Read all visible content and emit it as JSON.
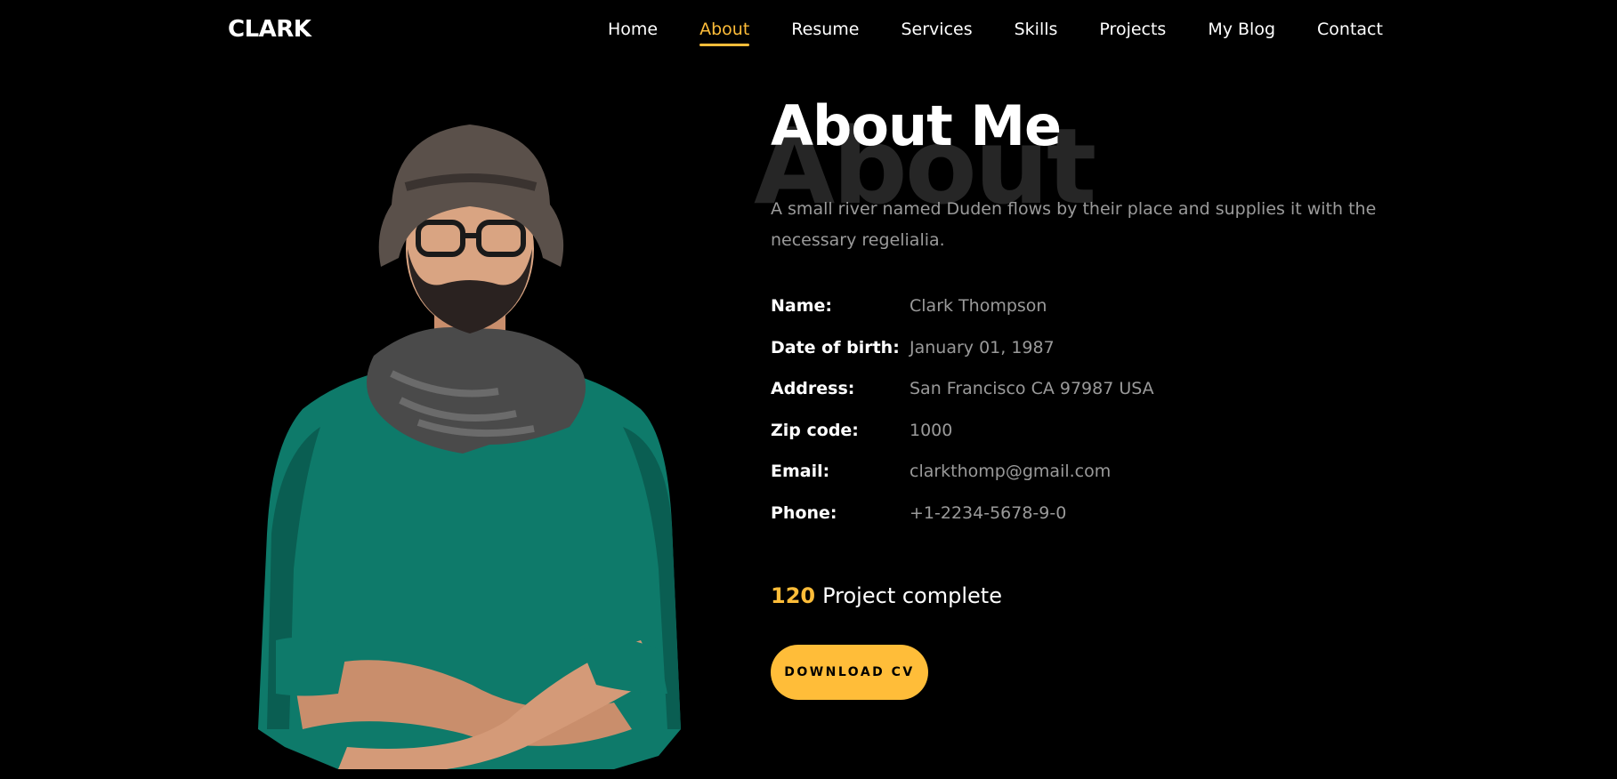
{
  "brand": "CLARK",
  "nav": {
    "items": [
      {
        "label": "Home",
        "active": false
      },
      {
        "label": "About",
        "active": true
      },
      {
        "label": "Resume",
        "active": false
      },
      {
        "label": "Services",
        "active": false
      },
      {
        "label": "Skills",
        "active": false
      },
      {
        "label": "Projects",
        "active": false
      },
      {
        "label": "My Blog",
        "active": false
      },
      {
        "label": "Contact",
        "active": false
      }
    ]
  },
  "about": {
    "background_word": "About",
    "title": "About Me",
    "intro": "A small river named Duden flows by their place and supplies it with the necessary regelialia.",
    "details": [
      {
        "label": "Name:",
        "value": "Clark Thompson"
      },
      {
        "label": "Date of birth:",
        "value": "January 01, 1987"
      },
      {
        "label": "Address:",
        "value": "San Francisco CA 97987 USA"
      },
      {
        "label": "Zip code:",
        "value": "1000"
      },
      {
        "label": "Email:",
        "value": "clarkthomp@gmail.com"
      },
      {
        "label": "Phone:",
        "value": "+1-2234-5678-9-0"
      }
    ],
    "counter": {
      "number": "120",
      "label": "Project complete"
    },
    "download_button": "DOWNLOAD CV"
  },
  "colors": {
    "accent": "#ffbd39",
    "background": "#000000",
    "muted_text": "#9a9a9a",
    "sweater": "#0e7a6a"
  },
  "portrait": {
    "icon": "person-portrait-photo"
  }
}
